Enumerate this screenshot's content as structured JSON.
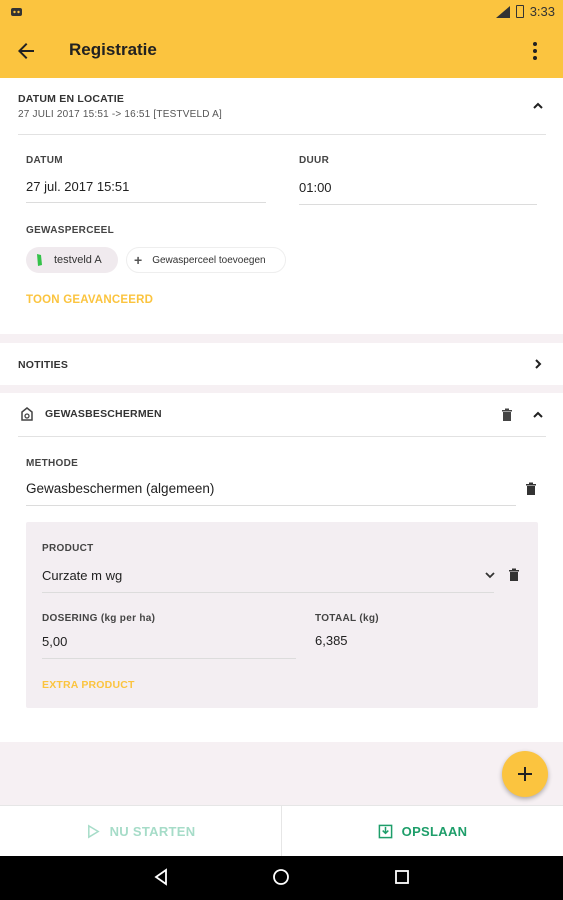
{
  "status_bar": {
    "time": "3:33"
  },
  "app_bar": {
    "title": "Registratie"
  },
  "datum_locatie": {
    "header": "DATUM EN LOCATIE",
    "summary": "27 JULI 2017 15:51 -> 16:51 [TESTVELD A]",
    "datum_label": "DATUM",
    "datum_value": "27 jul. 2017 15:51",
    "duur_label": "DUUR",
    "duur_value": "01:00",
    "gewasperceel_label": "GEWASPERCEEL",
    "chip_field": "testveld A",
    "chip_add": "Gewasperceel toevoegen",
    "advanced_link": "TOON GEAVANCEERD"
  },
  "notities": {
    "header": "NOTITIES"
  },
  "gewasbeschermen": {
    "header": "GEWASBESCHERMEN",
    "methode_label": "METHODE",
    "methode_value": "Gewasbeschermen (algemeen)",
    "product": {
      "product_label": "PRODUCT",
      "product_value": "Curzate m wg",
      "dosering_label": "DOSERING (kg per ha)",
      "dosering_value": "5,00",
      "totaal_label": "TOTAAL (kg)",
      "totaal_value": "6,385",
      "extra_link": "EXTRA PRODUCT"
    }
  },
  "bottom_actions": {
    "start_label": "NU STARTEN",
    "save_label": "OPSLAAN"
  },
  "colors": {
    "accent": "#fbc43f",
    "primary_green": "#1e9e6a",
    "disabled_green": "#a6dcc8"
  }
}
